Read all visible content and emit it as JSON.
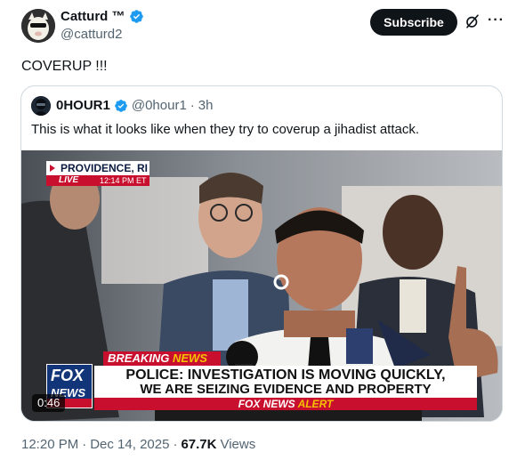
{
  "author": {
    "display_name": "Catturd ™",
    "handle": "@catturd2",
    "verified": true,
    "avatar_icon": "cartoon-avatar-icon"
  },
  "actions": {
    "subscribe_label": "Subscribe",
    "grok_icon": "grok-icon",
    "more_icon": "more-options-icon"
  },
  "post": {
    "text": "COVERUP !!!"
  },
  "quoted_post": {
    "display_name": "0HOUR1",
    "handle": "@0hour1",
    "separator": "·",
    "time": "3h",
    "verified": true,
    "text": "This is what it looks like when they try to coverup a jihadist attack.",
    "video": {
      "location": "PROVIDENCE, RI",
      "live_label": "LIVE",
      "live_time": "12:14 PM ET",
      "breaking_label": "BREAKING",
      "breaking_news": "NEWS",
      "headline_line1": "POLICE: INVESTIGATION IS MOVING QUICKLY,",
      "headline_line2": "WE ARE SEIZING EVIDENCE AND PROPERTY",
      "alert_prefix": "FOX NEWS",
      "alert_word": "ALERT",
      "logo_line1": "FOX",
      "logo_line2": "NEWS",
      "duration": "0:46"
    }
  },
  "meta": {
    "time": "12:20 PM",
    "sep1": "·",
    "date": "Dec 14, 2025",
    "sep2": "·",
    "views_count": "67.7K",
    "views_label": "Views"
  },
  "colors": {
    "verified_blue": "#1d9bf0",
    "text_primary": "#0f1419",
    "text_secondary": "#536471",
    "fox_red": "#c8102e",
    "fox_navy": "#12357a"
  }
}
